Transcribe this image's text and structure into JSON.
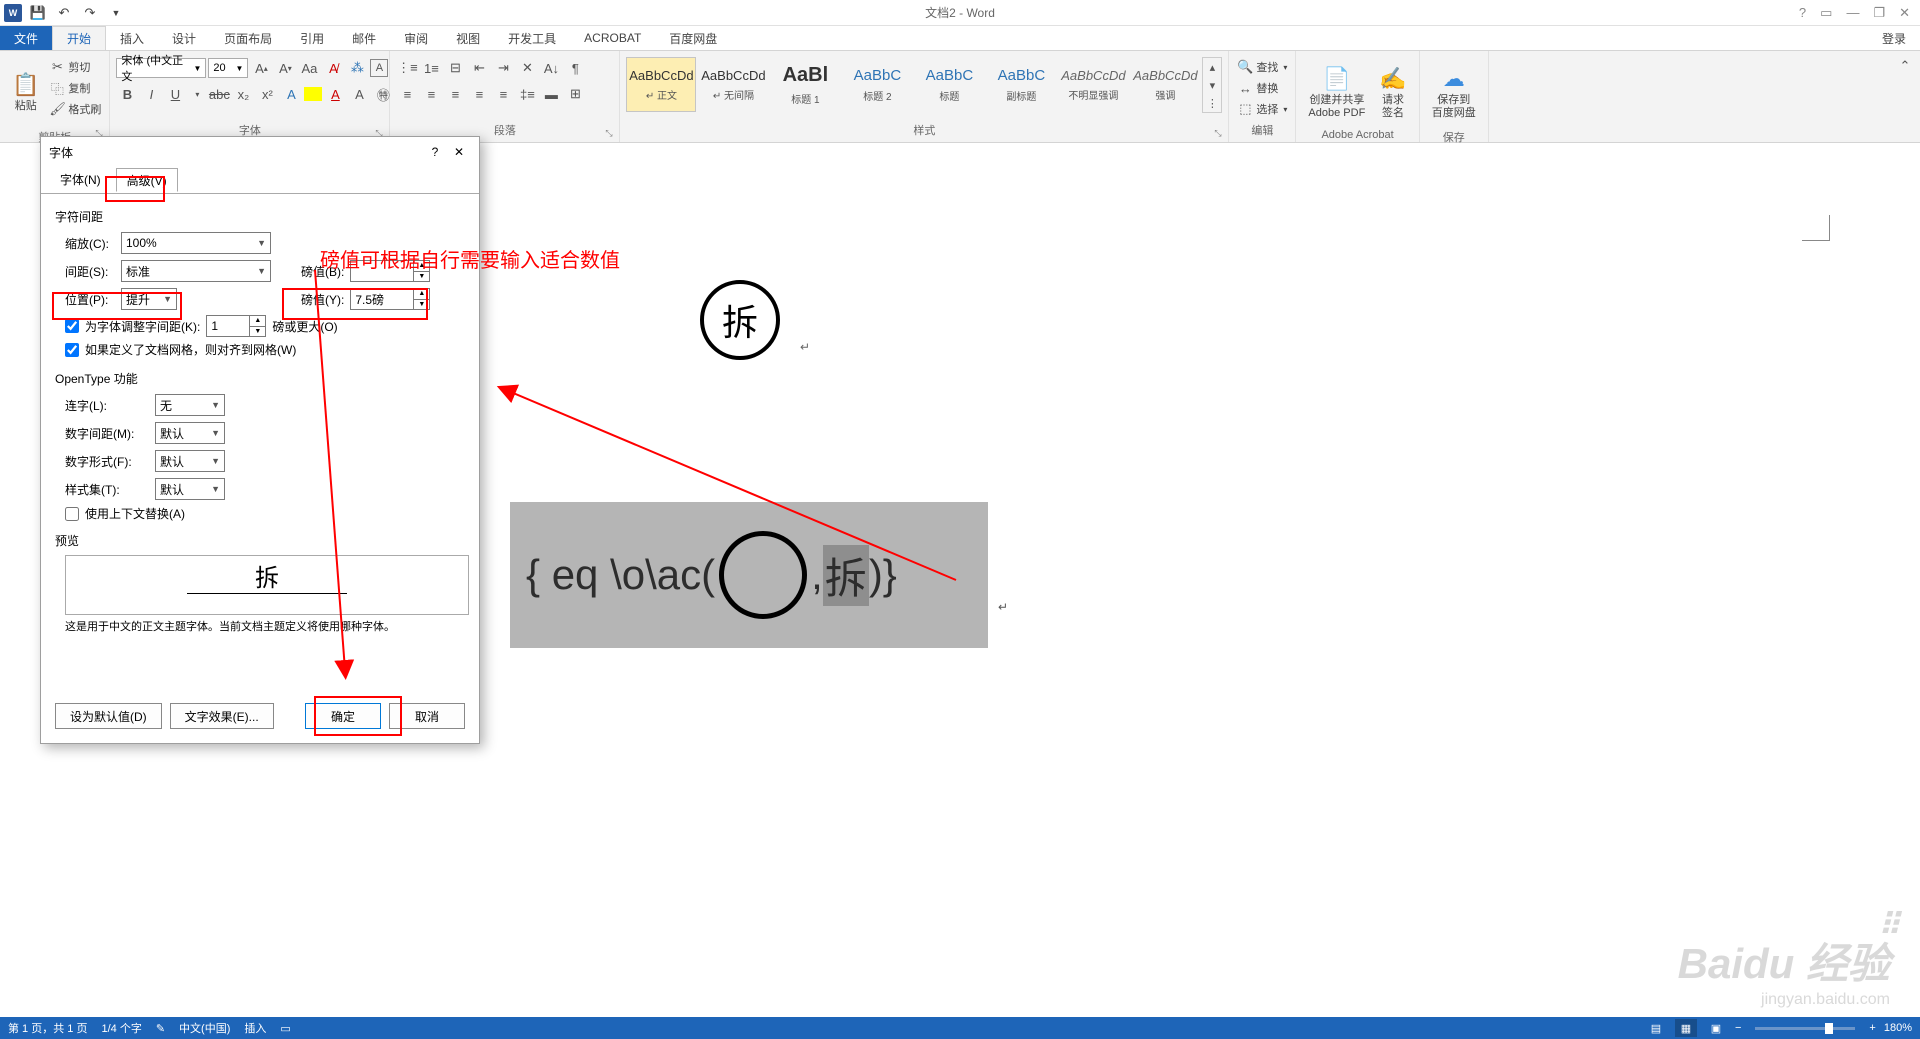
{
  "title_bar": {
    "doc_title": "文档2 - Word",
    "help": "?",
    "ribbon_toggle": "▭",
    "minimize": "—",
    "restore": "❐",
    "close": "✕"
  },
  "tabs": {
    "file": "文件",
    "home": "开始",
    "insert": "插入",
    "design": "设计",
    "layout": "页面布局",
    "references": "引用",
    "mailings": "邮件",
    "review": "审阅",
    "view": "视图",
    "developer": "开发工具",
    "acrobat": "ACROBAT",
    "baidu": "百度网盘",
    "login": "登录"
  },
  "ribbon": {
    "clipboard": {
      "label": "剪贴板",
      "paste": "粘贴",
      "cut": "剪切",
      "copy": "复制",
      "format_painter": "格式刷"
    },
    "font": {
      "label": "字体",
      "font_name": "宋体 (中文正文",
      "font_size": "20"
    },
    "paragraph": {
      "label": "段落"
    },
    "styles": {
      "label": "样式",
      "items": [
        {
          "preview": "AaBbCcDd",
          "name": "↵ 正文"
        },
        {
          "preview": "AaBbCcDd",
          "name": "↵ 无间隔"
        },
        {
          "preview": "AaBl",
          "name": "标题 1"
        },
        {
          "preview": "AaBbC",
          "name": "标题 2"
        },
        {
          "preview": "AaBbC",
          "name": "标题"
        },
        {
          "preview": "AaBbC",
          "name": "副标题"
        },
        {
          "preview": "AaBbCcDd",
          "name": "不明显强调"
        },
        {
          "preview": "AaBbCcDd",
          "name": "强调"
        }
      ]
    },
    "editing": {
      "label": "编辑",
      "find": "查找",
      "replace": "替换",
      "select": "选择"
    },
    "acrobat": {
      "label": "Adobe Acrobat",
      "create_share": "创建并共享",
      "adobe_pdf": "Adobe PDF",
      "request": "请求",
      "sign": "签名"
    },
    "baidu": {
      "label": "保存",
      "save_to": "保存到",
      "netdisk": "百度网盘"
    }
  },
  "dialog": {
    "title": "字体",
    "tab_font": "字体(N)",
    "tab_advanced": "高级(V)",
    "section_spacing": "字符间距",
    "scale_label": "缩放(C):",
    "scale_value": "100%",
    "spacing_label": "间距(S):",
    "spacing_value": "标准",
    "spacing_pt_label": "磅值(B):",
    "spacing_pt_value": "",
    "position_label": "位置(P):",
    "position_value": "提升",
    "position_pt_label": "磅值(Y):",
    "position_pt_value": "7.5磅",
    "kerning_check": "为字体调整字间距(K):",
    "kerning_value": "1",
    "kerning_unit": "磅或更大(O)",
    "grid_check": "如果定义了文档网格，则对齐到网格(W)",
    "section_opentype": "OpenType 功能",
    "ligatures_label": "连字(L):",
    "ligatures_value": "无",
    "num_spacing_label": "数字间距(M):",
    "num_spacing_value": "默认",
    "num_form_label": "数字形式(F):",
    "num_form_value": "默认",
    "stylistic_label": "样式集(T):",
    "stylistic_value": "默认",
    "contextual_check": "使用上下文替换(A)",
    "section_preview": "预览",
    "preview_text": "拆",
    "note": "这是用于中文的正文主题字体。当前文档主题定义将使用哪种字体。",
    "btn_default": "设为默认值(D)",
    "btn_text_effects": "文字效果(E)...",
    "btn_ok": "确定",
    "btn_cancel": "取消"
  },
  "annotation": {
    "hint": "磅值可根据自行需要输入适合数值"
  },
  "document": {
    "circle_char": "拆",
    "field_left": "{ eq \\o\\ac(",
    "field_mid": ",",
    "field_sel": "拆",
    "field_right": ")}"
  },
  "statusbar": {
    "page": "第 1 页，共 1 页",
    "words": "1/4 个字",
    "language": "中文(中国)",
    "mode": "插入",
    "zoom": "180%"
  },
  "watermark": {
    "main": "Baidu 经验",
    "sub": "jingyan.baidu.com"
  }
}
